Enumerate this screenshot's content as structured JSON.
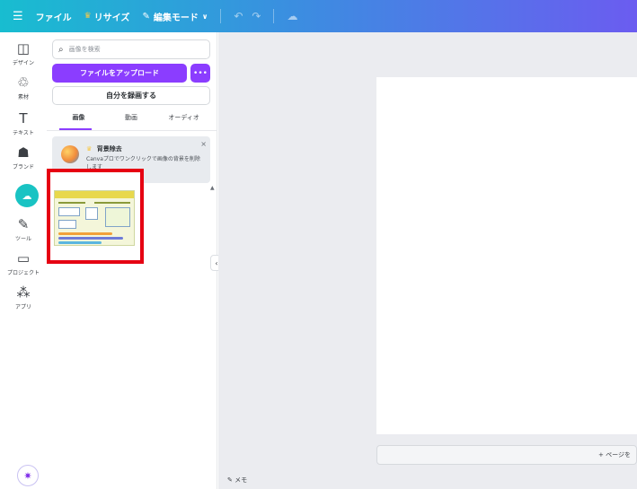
{
  "topbar": {
    "menu_icon": "hamburger-icon",
    "file_label": "ファイル",
    "resize_label": "リサイズ",
    "edit_mode_label": "編集モード",
    "edit_mode_chevron": "∨"
  },
  "rail": {
    "items": [
      {
        "label": "デザイン",
        "icon": "◫"
      },
      {
        "label": "素材",
        "icon": "♲"
      },
      {
        "label": "テキスト",
        "icon": "T"
      },
      {
        "label": "ブランド",
        "icon": "☗"
      },
      {
        "label": "",
        "icon": "☁"
      },
      {
        "label": "ツール",
        "icon": "✎"
      },
      {
        "label": "プロジェクト",
        "icon": "▭"
      },
      {
        "label": "アプリ",
        "icon": "⁂"
      }
    ]
  },
  "panel": {
    "search_placeholder": "画像を検索",
    "upload_label": "ファイルをアップロード",
    "more_label": "•••",
    "record_label": "自分を録画する",
    "tabs": [
      "画像",
      "動画",
      "オーディオ"
    ],
    "promo_title": "背景除去",
    "promo_text": "Canvaプロでワンクリックで画像の背景を削除します",
    "promo_close": "×"
  },
  "canvas": {
    "add_page_label": "+ ページを",
    "memo_label": "メモ"
  },
  "colors": {
    "accent": "#8b3dff",
    "highlight_box": "#e60012",
    "teal": "#19c3c3"
  }
}
